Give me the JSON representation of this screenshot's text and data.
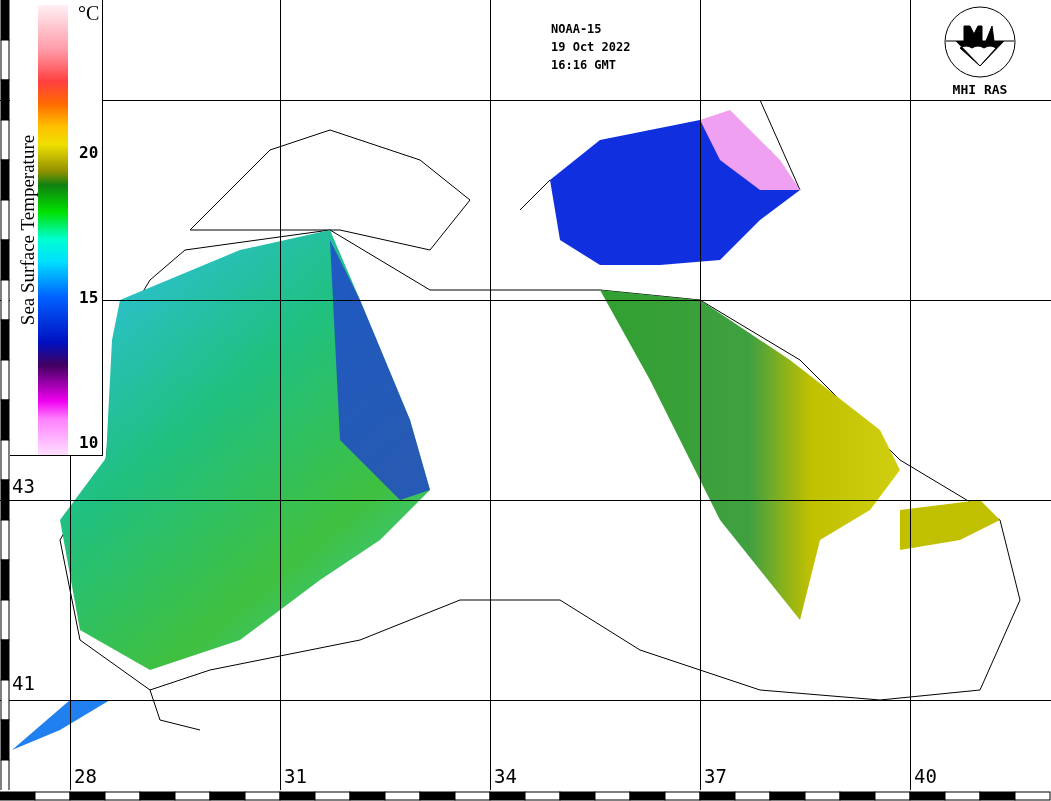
{
  "header": {
    "satellite": "NOAA-15",
    "date": "19 Oct 2022",
    "time": "16:16 GMT"
  },
  "logo": {
    "text": "MHI RAS"
  },
  "colorbar": {
    "title": "Sea Surface Temperature",
    "unit": "°C",
    "ticks": [
      "20",
      "15",
      "10"
    ]
  },
  "map": {
    "latitude_labels": [
      "43",
      "41"
    ],
    "longitude_labels": [
      "28",
      "31",
      "34",
      "37",
      "40"
    ]
  }
}
